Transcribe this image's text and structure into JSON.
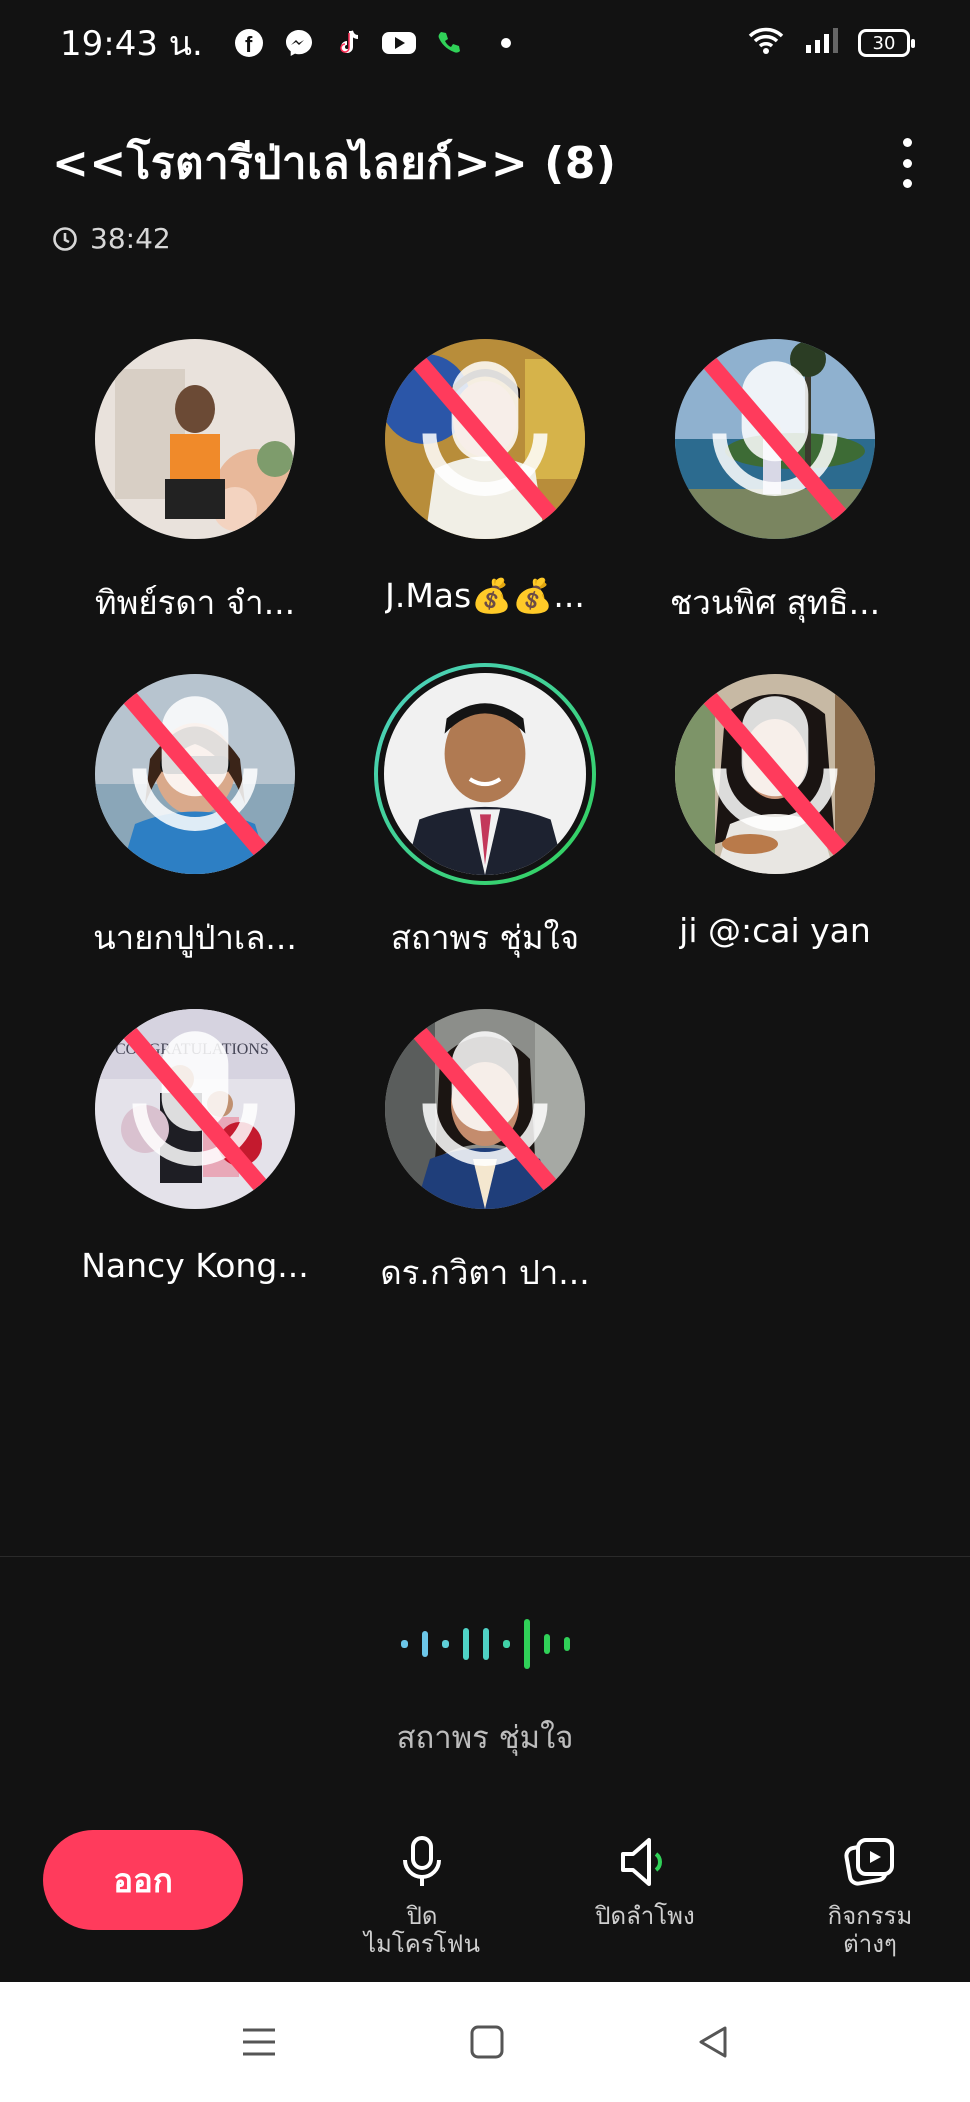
{
  "status_bar": {
    "time": "19:43 น.",
    "battery": "30",
    "apps": [
      "facebook-icon",
      "messenger-icon",
      "tiktok-icon",
      "youtube-icon",
      "phone-icon"
    ]
  },
  "header": {
    "title": "<<โรตารีป่าเลไลยก์>> (8)",
    "timer": "38:42"
  },
  "participants": [
    {
      "name": "ทิพย์รดา จำ...",
      "muted": false,
      "speaking": false
    },
    {
      "name": "J.Mas💰💰...",
      "muted": true,
      "speaking": false
    },
    {
      "name": "ชวนพิศ สุทธิ...",
      "muted": true,
      "speaking": false
    },
    {
      "name": "นายกปูป่าเล...",
      "muted": true,
      "speaking": false
    },
    {
      "name": "สถาพร ชุ่มใจ",
      "muted": false,
      "speaking": true
    },
    {
      "name": "ji @:cai yan",
      "muted": true,
      "speaking": false
    },
    {
      "name": "Nancy Kong...",
      "muted": true,
      "speaking": false
    },
    {
      "name": "ดร.กวิตา ปา...",
      "muted": true,
      "speaking": false
    }
  ],
  "active_speaker": {
    "name": "สถาพร ชุ่มใจ"
  },
  "controls": {
    "leave_label": "ออก",
    "mic_label_line1": "ปิด",
    "mic_label_line2": "ไมโครโฟน",
    "speaker_label": "ปิดลำโพง",
    "activities_line1": "กิจกรรม",
    "activities_line2": "ต่างๆ"
  },
  "colors": {
    "background": "#121212",
    "leave": "#ff3b5c",
    "speaking_ring": "#4fd1c5",
    "active_green": "#30d158"
  }
}
